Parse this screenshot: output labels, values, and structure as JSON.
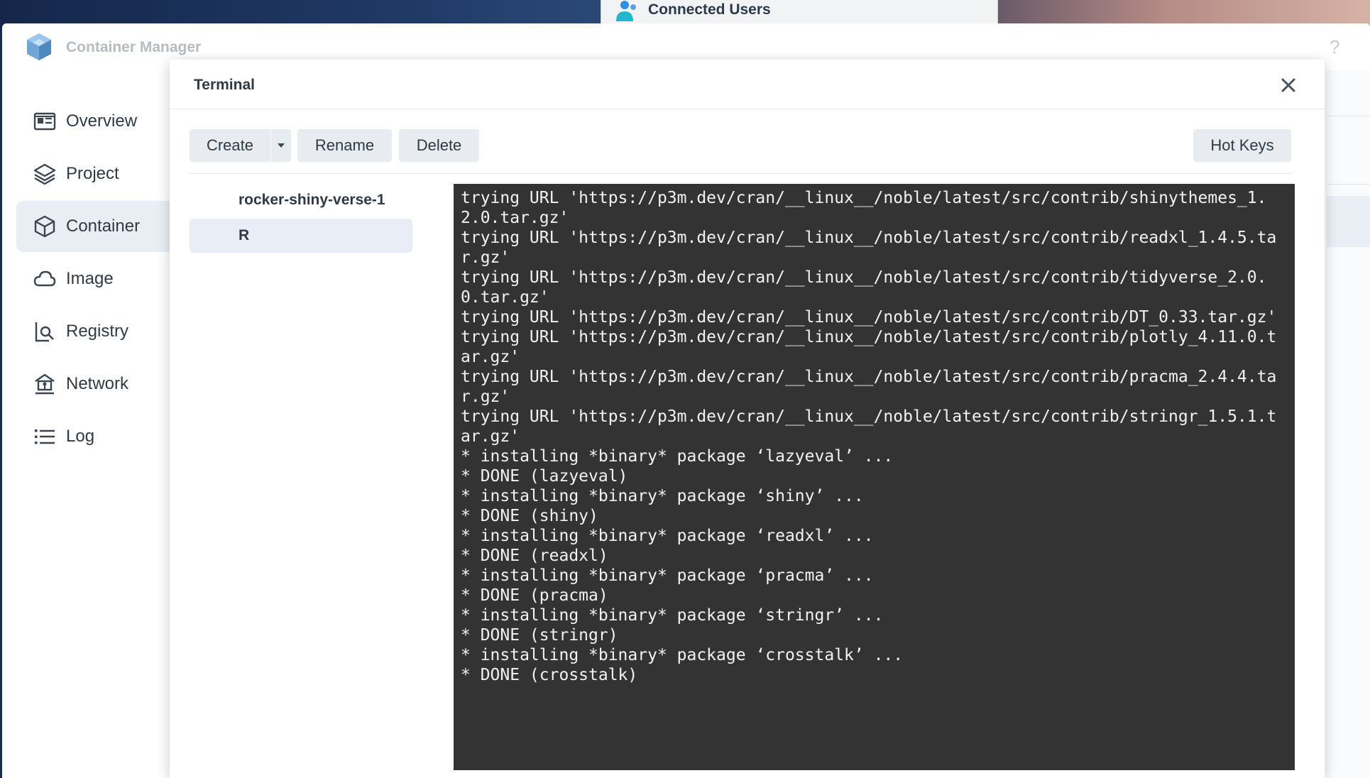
{
  "taskbar": {
    "connected_users_label": "Connected Users"
  },
  "app": {
    "title": "Container Manager",
    "help_label": "?"
  },
  "sidebar": {
    "items": [
      {
        "label": "Overview",
        "icon": "overview-icon"
      },
      {
        "label": "Project",
        "icon": "layers-icon"
      },
      {
        "label": "Container",
        "icon": "cube-icon",
        "active": true
      },
      {
        "label": "Image",
        "icon": "cloud-icon"
      },
      {
        "label": "Registry",
        "icon": "registry-search-icon"
      },
      {
        "label": "Network",
        "icon": "network-icon"
      },
      {
        "label": "Log",
        "icon": "list-icon"
      }
    ]
  },
  "dialog": {
    "title": "Terminal",
    "toolbar": {
      "create_label": "Create",
      "rename_label": "Rename",
      "delete_label": "Delete",
      "hotkeys_label": "Hot Keys"
    },
    "sessions": [
      {
        "label": "rocker-shiny-verse-1",
        "selected": false
      },
      {
        "label": "R",
        "selected": true
      }
    ],
    "terminal_lines": [
      "trying URL 'https://p3m.dev/cran/__linux__/noble/latest/src/contrib/shinythemes_1.2.0.tar.gz'",
      "trying URL 'https://p3m.dev/cran/__linux__/noble/latest/src/contrib/readxl_1.4.5.tar.gz'",
      "trying URL 'https://p3m.dev/cran/__linux__/noble/latest/src/contrib/tidyverse_2.0.0.tar.gz'",
      "trying URL 'https://p3m.dev/cran/__linux__/noble/latest/src/contrib/DT_0.33.tar.gz'",
      "trying URL 'https://p3m.dev/cran/__linux__/noble/latest/src/contrib/plotly_4.11.0.tar.gz'",
      "trying URL 'https://p3m.dev/cran/__linux__/noble/latest/src/contrib/pracma_2.4.4.tar.gz'",
      "trying URL 'https://p3m.dev/cran/__linux__/noble/latest/src/contrib/stringr_1.5.1.tar.gz'",
      "* installing *binary* package ‘lazyeval’ ...",
      "* DONE (lazyeval)",
      "* installing *binary* package ‘shiny’ ...",
      "* DONE (shiny)",
      "* installing *binary* package ‘readxl’ ...",
      "* DONE (readxl)",
      "* installing *binary* package ‘pracma’ ...",
      "* DONE (pracma)",
      "* installing *binary* package ‘stringr’ ...",
      "* DONE (stringr)",
      "* installing *binary* package ‘crosstalk’ ...",
      "* DONE (crosstalk)"
    ]
  },
  "colors": {
    "terminal_bg": "#333333",
    "terminal_fg": "#f2f2f2",
    "active_nav_bg": "#e9eef5",
    "button_bg": "#e8ebef"
  }
}
